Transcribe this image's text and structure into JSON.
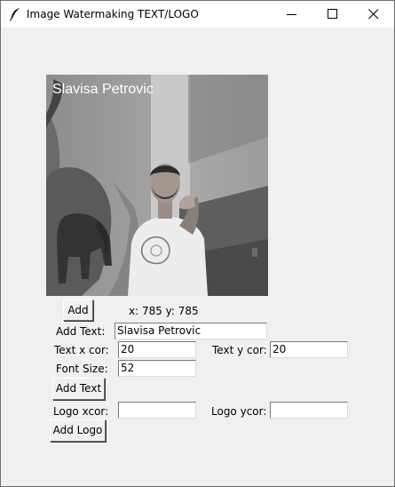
{
  "window": {
    "title": "Image Watermaking TEXT/LOGO"
  },
  "preview": {
    "watermark_text": "Slavisa Petrovic"
  },
  "controls": {
    "add_button": "Add",
    "coords_readout": "x: 785 y: 785",
    "add_text_label": "Add Text:",
    "add_text_value": "Slavisa Petrovic",
    "text_x_label": "Text x cor:",
    "text_x_value": "20",
    "text_y_label": "Text y cor:",
    "text_y_value": "20",
    "font_size_label": "Font Size:",
    "font_size_value": "52",
    "add_text_button": "Add Text",
    "logo_x_label": "Logo xcor:",
    "logo_x_value": "",
    "logo_y_label": "Logo ycor:",
    "logo_y_value": "",
    "add_logo_button": "Add Logo"
  },
  "icons": {
    "app": "feather-icon",
    "minimize": "minimize-icon",
    "maximize": "maximize-icon",
    "close": "close-icon"
  }
}
